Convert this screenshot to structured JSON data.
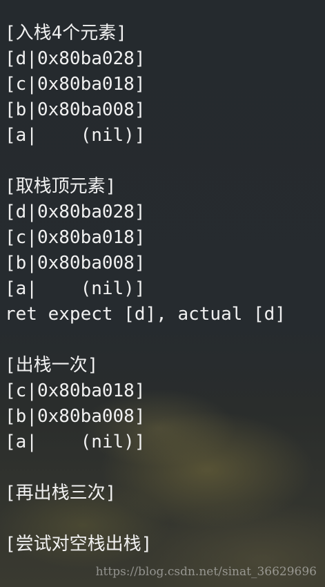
{
  "terminal": {
    "lines": [
      "[入栈4个元素]",
      "[d|0x80ba028]",
      "[c|0x80ba018]",
      "[b|0x80ba008]",
      "[a|    (nil)]",
      "",
      "[取栈顶元素]",
      "[d|0x80ba028]",
      "[c|0x80ba018]",
      "[b|0x80ba008]",
      "[a|    (nil)]",
      "ret expect [d], actual [d]",
      "",
      "[出栈一次]",
      "[c|0x80ba018]",
      "[b|0x80ba008]",
      "[a|    (nil)]",
      "",
      "[再出栈三次]",
      "",
      "[尝试对空栈出栈]"
    ]
  },
  "watermark": "https://blog.csdn.net/sinat_36629696"
}
